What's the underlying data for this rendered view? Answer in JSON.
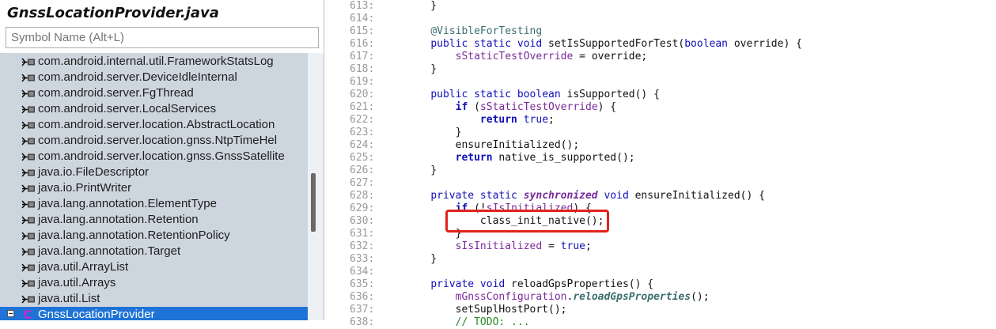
{
  "left_panel": {
    "file_title": "GnssLocationProvider.java",
    "search_placeholder": "Symbol Name (Alt+L)",
    "symbols": [
      "com.android.internal.util.FrameworkStatsLog",
      "com.android.server.DeviceIdleInternal",
      "com.android.server.FgThread",
      "com.android.server.LocalServices",
      "com.android.server.location.AbstractLocation",
      "com.android.server.location.gnss.NtpTimeHel",
      "com.android.server.location.gnss.GnssSatellite",
      "java.io.FileDescriptor",
      "java.io.PrintWriter",
      "java.lang.annotation.ElementType",
      "java.lang.annotation.Retention",
      "java.lang.annotation.RetentionPolicy",
      "java.lang.annotation.Target",
      "java.util.ArrayList",
      "java.util.Arrays",
      "java.util.List"
    ],
    "selected_class": "GnssLocationProvider"
  },
  "code": {
    "lines": [
      {
        "num": "613:",
        "segs": [
          [
            "p",
            "    }"
          ]
        ]
      },
      {
        "num": "614:",
        "segs": []
      },
      {
        "num": "615:",
        "segs": [
          [
            "p",
            "    "
          ],
          [
            "ann",
            "@VisibleForTesting"
          ]
        ]
      },
      {
        "num": "616:",
        "segs": [
          [
            "p",
            "    "
          ],
          [
            "kw",
            "public static void"
          ],
          [
            "p",
            " setIsSupportedForTest("
          ],
          [
            "kw",
            "boolean"
          ],
          [
            "p",
            " override) {"
          ]
        ]
      },
      {
        "num": "617:",
        "segs": [
          [
            "p",
            "        "
          ],
          [
            "fld",
            "sStaticTestOverride"
          ],
          [
            "p",
            " = override;"
          ]
        ]
      },
      {
        "num": "618:",
        "segs": [
          [
            "p",
            "    }"
          ]
        ]
      },
      {
        "num": "619:",
        "segs": []
      },
      {
        "num": "620:",
        "segs": [
          [
            "p",
            "    "
          ],
          [
            "kw",
            "public static boolean"
          ],
          [
            "p",
            " isSupported() {"
          ]
        ]
      },
      {
        "num": "621:",
        "segs": [
          [
            "p",
            "        "
          ],
          [
            "kwb",
            "if"
          ],
          [
            "p",
            " ("
          ],
          [
            "fld",
            "sStaticTestOverride"
          ],
          [
            "p",
            ") {"
          ]
        ]
      },
      {
        "num": "622:",
        "segs": [
          [
            "p",
            "            "
          ],
          [
            "kwb",
            "return"
          ],
          [
            "p",
            " "
          ],
          [
            "kw",
            "true"
          ],
          [
            "p",
            ";"
          ]
        ]
      },
      {
        "num": "623:",
        "segs": [
          [
            "p",
            "        }"
          ]
        ]
      },
      {
        "num": "624:",
        "segs": [
          [
            "p",
            "        ensureInitialized();"
          ]
        ]
      },
      {
        "num": "625:",
        "segs": [
          [
            "p",
            "        "
          ],
          [
            "kwb",
            "return"
          ],
          [
            "p",
            " native_is_supported();"
          ]
        ]
      },
      {
        "num": "626:",
        "segs": [
          [
            "p",
            "    }"
          ]
        ]
      },
      {
        "num": "627:",
        "segs": []
      },
      {
        "num": "628:",
        "segs": [
          [
            "p",
            "    "
          ],
          [
            "kw",
            "private static "
          ],
          [
            "kwi",
            "synchronized"
          ],
          [
            "kw",
            " void"
          ],
          [
            "p",
            " ensureInitialized() {"
          ]
        ]
      },
      {
        "num": "629:",
        "segs": [
          [
            "p",
            "        "
          ],
          [
            "kwb",
            "if"
          ],
          [
            "p",
            " (!"
          ],
          [
            "fld",
            "sIsInitialized"
          ],
          [
            "p",
            ") {"
          ]
        ]
      },
      {
        "num": "630:",
        "segs": [
          [
            "p",
            "            class_init_native();"
          ]
        ]
      },
      {
        "num": "631:",
        "segs": [
          [
            "p",
            "        }"
          ]
        ]
      },
      {
        "num": "632:",
        "segs": [
          [
            "p",
            "        "
          ],
          [
            "fld",
            "sIsInitialized"
          ],
          [
            "p",
            " = "
          ],
          [
            "kw",
            "true"
          ],
          [
            "p",
            ";"
          ]
        ]
      },
      {
        "num": "633:",
        "segs": [
          [
            "p",
            "    }"
          ]
        ]
      },
      {
        "num": "634:",
        "segs": []
      },
      {
        "num": "635:",
        "segs": [
          [
            "p",
            "    "
          ],
          [
            "kw",
            "private void"
          ],
          [
            "p",
            " reloadGpsProperties() {"
          ]
        ]
      },
      {
        "num": "636:",
        "segs": [
          [
            "p",
            "        "
          ],
          [
            "fld",
            "mGnssConfiguration"
          ],
          [
            "p",
            "."
          ],
          [
            "mcall",
            "reloadGpsProperties"
          ],
          [
            "p",
            "();"
          ]
        ]
      },
      {
        "num": "637:",
        "segs": [
          [
            "p",
            "        setSuplHostPort();"
          ]
        ]
      },
      {
        "num": "638:",
        "segs": [
          [
            "p",
            "        "
          ],
          [
            "cmt",
            "// TODO: ..."
          ]
        ]
      }
    ]
  },
  "colors": {
    "keyword": "#1010b8",
    "field": "#7a2a9a",
    "annotation": "#3b6e6e",
    "selection": "#1f73d6",
    "highlight_box": "#e0231c",
    "symbol_panel_bg": "#cdd6df"
  },
  "icons": {
    "import": "import-icon",
    "class": "class-c-icon",
    "collapse": "tree-collapse-icon"
  }
}
